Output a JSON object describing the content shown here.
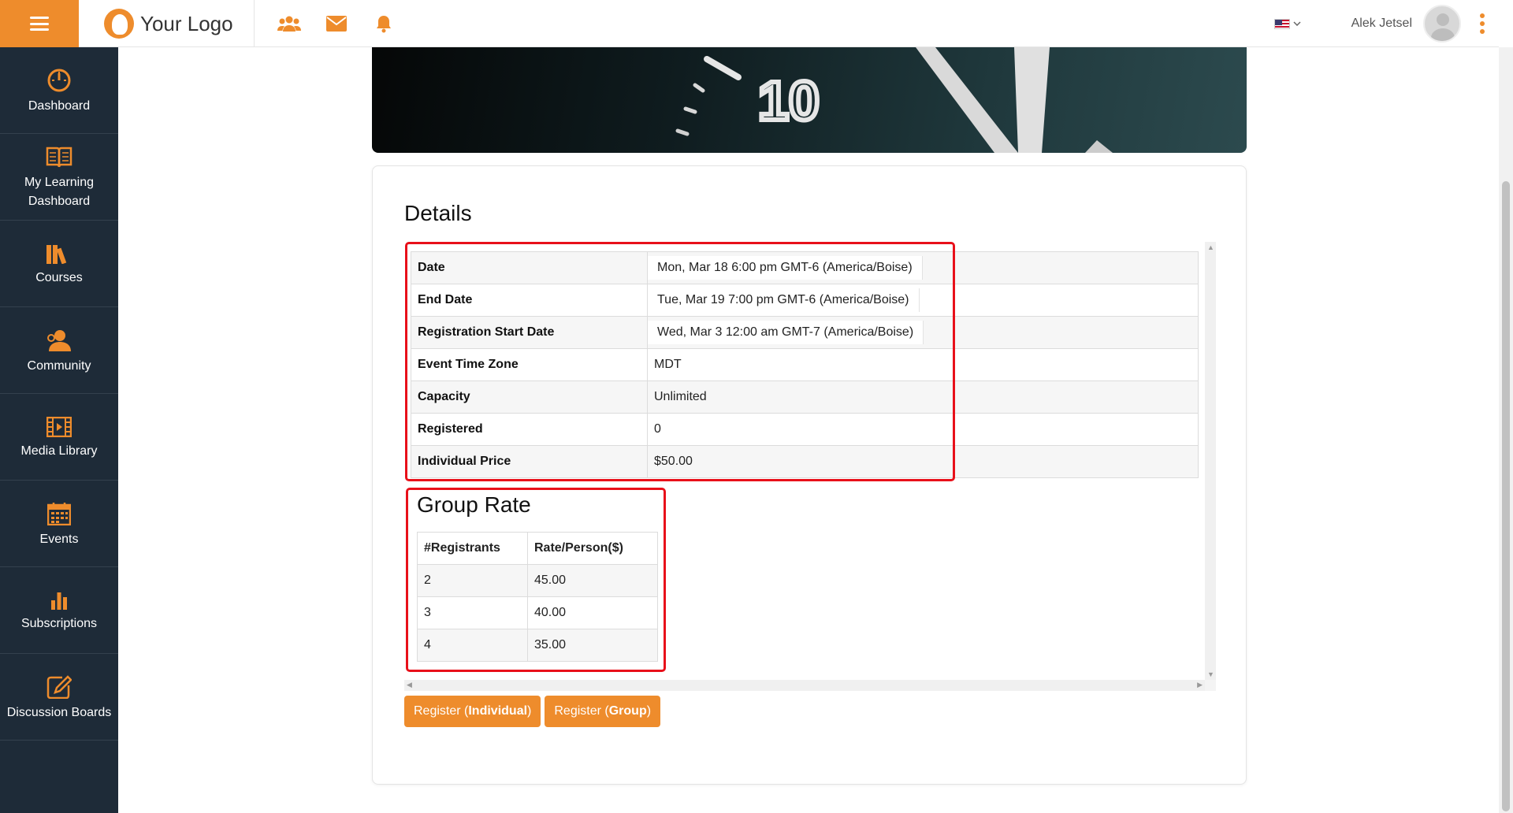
{
  "header": {
    "logo_text": "Your Logo",
    "user_name": "Alek Jetsel"
  },
  "sidebar": {
    "items": [
      {
        "label": "Dashboard",
        "icon": "dashboard-icon"
      },
      {
        "label": "My Learning Dashboard",
        "icon": "book-icon"
      },
      {
        "label": "Courses",
        "icon": "books-icon"
      },
      {
        "label": "Community",
        "icon": "community-icon"
      },
      {
        "label": "Media Library",
        "icon": "film-icon"
      },
      {
        "label": "Events",
        "icon": "calendar-icon"
      },
      {
        "label": "Subscriptions",
        "icon": "bar-chart-icon"
      },
      {
        "label": "Discussion Boards",
        "icon": "edit-icon"
      }
    ]
  },
  "details": {
    "title": "Details",
    "rows": [
      {
        "label": "Date",
        "value": "Mon, Mar 18 6:00 pm GMT-6 (America/Boise)"
      },
      {
        "label": "End Date",
        "value": "Tue, Mar 19 7:00 pm GMT-6 (America/Boise)"
      },
      {
        "label": "Registration Start Date",
        "value": "Wed, Mar 3 12:00 am GMT-7 (America/Boise)"
      },
      {
        "label": "Event Time Zone",
        "value": "MDT"
      },
      {
        "label": "Capacity",
        "value": "Unlimited"
      },
      {
        "label": "Registered",
        "value": "0"
      },
      {
        "label": "Individual Price",
        "value": "$50.00"
      }
    ]
  },
  "group_rate": {
    "title": "Group Rate",
    "headers": [
      "#Registrants",
      "Rate/Person($)"
    ],
    "rows": [
      [
        "2",
        "45.00"
      ],
      [
        "3",
        "40.00"
      ],
      [
        "4",
        "35.00"
      ]
    ]
  },
  "hero": {
    "clock_numeral": "10"
  },
  "buttons": {
    "individual_prefix": "Register (",
    "individual_bold": "Individual",
    "group_prefix": "Register (",
    "group_bold": "Group",
    "suffix": ")"
  },
  "colors": {
    "accent": "#ee8c2c",
    "sidebar_bg": "#1e2b38",
    "highlight": "#e8101a"
  }
}
